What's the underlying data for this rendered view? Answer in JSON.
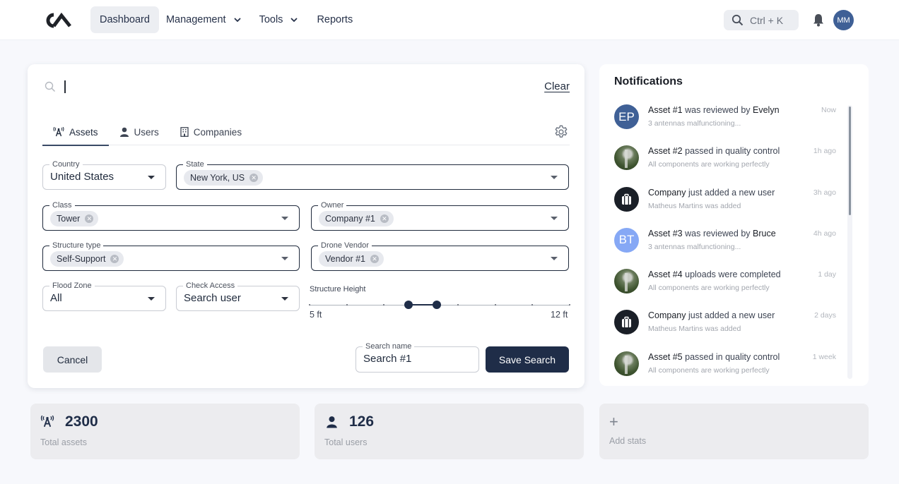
{
  "topbar": {
    "logo_text": "CA",
    "nav": [
      {
        "label": "Dashboard",
        "active": true,
        "has_dropdown": false
      },
      {
        "label": "Management",
        "active": false,
        "has_dropdown": true
      },
      {
        "label": "Tools",
        "active": false,
        "has_dropdown": true
      },
      {
        "label": "Reports",
        "active": false,
        "has_dropdown": false
      }
    ],
    "command_search_hint": "Ctrl + K",
    "user_initials": "MM",
    "icons": {
      "search": "search-icon",
      "notifications": "bell-icon"
    }
  },
  "search_panel": {
    "query_value": "",
    "clear_label": "Clear",
    "tabs": [
      {
        "label": "Assets",
        "icon": "tower-icon",
        "active": true
      },
      {
        "label": "Users",
        "icon": "user-icon",
        "active": false
      },
      {
        "label": "Companies",
        "icon": "building-icon",
        "active": false
      }
    ],
    "filters": {
      "country": {
        "label": "Country",
        "value": "United States"
      },
      "state": {
        "label": "State",
        "chips": [
          "New York, US"
        ]
      },
      "class": {
        "label": "Class",
        "chips": [
          "Tower"
        ]
      },
      "owner": {
        "label": "Owner",
        "chips": [
          "Company #1"
        ]
      },
      "structure_type": {
        "label": "Structure type",
        "chips": [
          "Self-Support"
        ]
      },
      "drone_vendor": {
        "label": "Drone Vendor",
        "chips": [
          "Vendor #1"
        ]
      },
      "flood_zone": {
        "label": "Flood Zone",
        "value": "All"
      },
      "check_access": {
        "label": "Check Access",
        "value": "Search user"
      }
    },
    "structure_height": {
      "label": "Structure Height",
      "min": 5,
      "max": 12,
      "min_label": "5 ft",
      "max_label": "12 ft",
      "steps": 7,
      "selected_low": 7.66,
      "selected_high": 8.42
    },
    "cancel_label": "Cancel",
    "search_name": {
      "label": "Search name",
      "value": "Search #1"
    },
    "save_label": "Save Search"
  },
  "notifications": {
    "title": "Notifications",
    "scroll_position": 0,
    "items": [
      {
        "avatar_type": "initials",
        "avatar_text": "EP",
        "avatar_color": "#3f6096",
        "subject": "Asset #1",
        "action": " was reviewed by ",
        "actor": "Evelyn",
        "detail": "3 antennas malfunctioning...",
        "time": "Now"
      },
      {
        "avatar_type": "photo",
        "avatar_text": "",
        "avatar_color": "",
        "subject": "Asset #2",
        "action": " passed in quality control",
        "actor": "",
        "detail": "All components are working perfectly",
        "time": "1h ago"
      },
      {
        "avatar_type": "company",
        "avatar_text": "",
        "avatar_color": "#1a1f27",
        "subject": "Company",
        "action": " just added a new user",
        "actor": "",
        "detail": "Matheus Martins was added",
        "time": "3h ago"
      },
      {
        "avatar_type": "initials",
        "avatar_text": "BT",
        "avatar_color": "#86a8f5",
        "subject": "Asset #3",
        "action": " was reviewed by ",
        "actor": "Bruce",
        "detail": "3 antennas malfunctioning...",
        "time": "4h ago"
      },
      {
        "avatar_type": "photo",
        "avatar_text": "",
        "avatar_color": "",
        "subject": "Asset #4",
        "action": " uploads were completed",
        "actor": "",
        "detail": "All components are working perfectly",
        "time": "1 day"
      },
      {
        "avatar_type": "company",
        "avatar_text": "",
        "avatar_color": "#1a1f27",
        "subject": "Company",
        "action": " just added a new user",
        "actor": "",
        "detail": "Matheus Martins was added",
        "time": "2 days"
      },
      {
        "avatar_type": "photo",
        "avatar_text": "",
        "avatar_color": "",
        "subject": "Asset #5",
        "action": " passed in quality control",
        "actor": "",
        "detail": "All components are working perfectly",
        "time": "1 week"
      }
    ]
  },
  "stats": [
    {
      "icon": "tower-icon",
      "value": "2300",
      "caption": "Total assets"
    },
    {
      "icon": "user-icon",
      "value": "126",
      "caption": "Total users"
    }
  ],
  "add_stats": {
    "label": "Add stats",
    "icon": "plus-icon"
  }
}
